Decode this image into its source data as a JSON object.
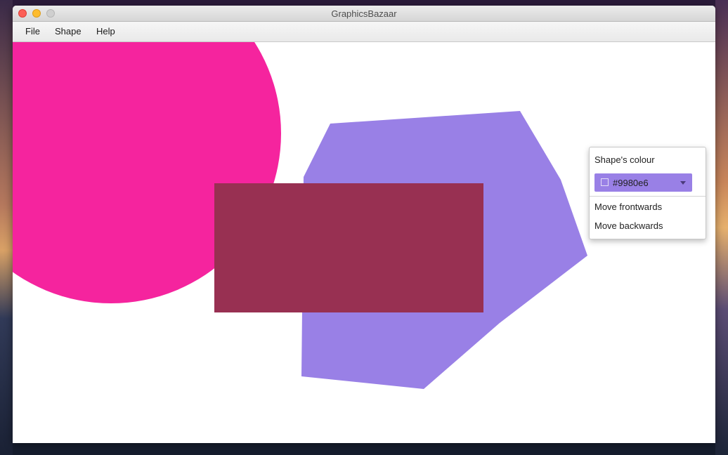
{
  "window": {
    "title": "GraphicsBazaar"
  },
  "menu": {
    "file": "File",
    "shape": "Shape",
    "help": "Help"
  },
  "canvas": {
    "shapes": [
      {
        "kind": "circle",
        "color": "#f5249e"
      },
      {
        "kind": "polygon",
        "color": "#9980e6"
      },
      {
        "kind": "rectangle",
        "color": "#983052"
      }
    ]
  },
  "context_menu": {
    "label": "Shape's colour",
    "color_value": "#9980e6",
    "move_frontwards": "Move frontwards",
    "move_backwards": "Move backwards"
  }
}
